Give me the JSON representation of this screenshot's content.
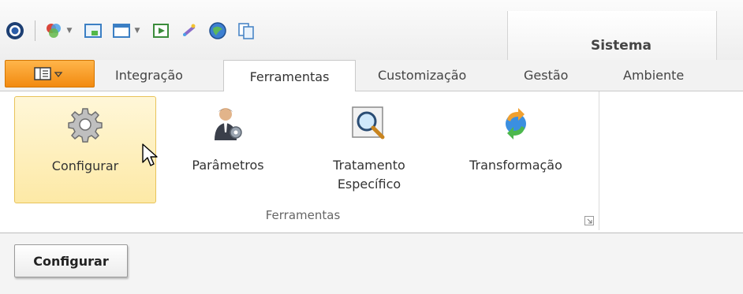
{
  "quick_access": {
    "icons": [
      "app-logo-icon",
      "palette-icon",
      "window-minimize-icon",
      "window-icon",
      "play-icon",
      "magic-icon",
      "globe-icon",
      "copy-icon"
    ]
  },
  "context_tab": {
    "label": "Sistema"
  },
  "tabs": {
    "items": [
      {
        "label": "Integração"
      },
      {
        "label": "Ferramentas"
      },
      {
        "label": "Customização"
      },
      {
        "label": "Gestão"
      },
      {
        "label": "Ambiente"
      }
    ]
  },
  "ribbon": {
    "group_label": "Ferramentas",
    "buttons": [
      {
        "label": "Configurar",
        "icon": "gear-icon"
      },
      {
        "label": "Parâmetros",
        "icon": "user-settings-icon"
      },
      {
        "label_line1": "Tratamento",
        "label_line2": "Específico",
        "icon": "magnifier-icon"
      },
      {
        "label": "Transformação",
        "icon": "transform-refresh-icon"
      }
    ]
  },
  "document_tabs": [
    {
      "label": "Configurar"
    }
  ],
  "colors": {
    "app_button": "#f28a10",
    "hover_fill": "#fde9a6",
    "hover_border": "#e8c35a"
  }
}
